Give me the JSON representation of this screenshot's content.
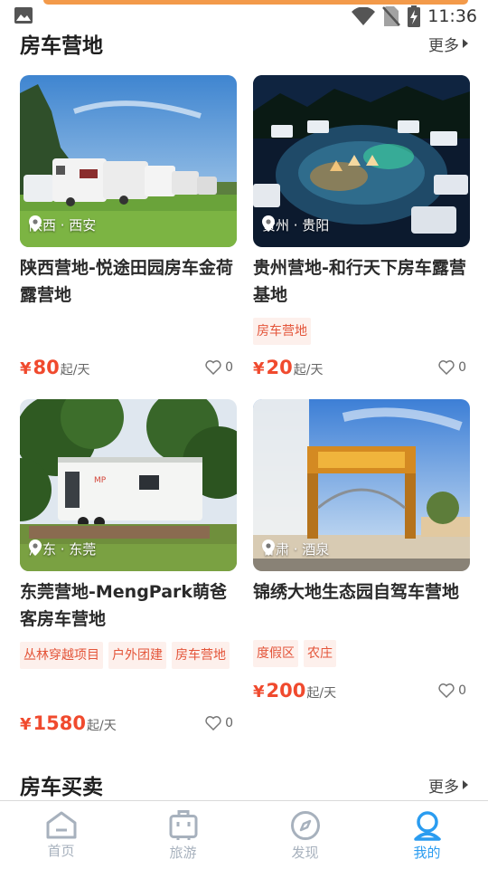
{
  "status_bar": {
    "time": "11:36"
  },
  "colors": {
    "accent": "#2a9cf0",
    "price": "#f04a2e",
    "tag_bg": "#fdf0ec",
    "tag_text": "#e4553a"
  },
  "sections": {
    "rv_camps": {
      "title": "房车营地",
      "more": "更多"
    },
    "rv_trade": {
      "title": "房车买卖",
      "more": "更多"
    }
  },
  "cards": [
    {
      "location": "陕西 · 西安",
      "title": "陕西营地-悦途田园房车金荷露营地",
      "tags": [],
      "price_symbol": "¥",
      "price": "80",
      "price_unit": "起/天",
      "likes": "0"
    },
    {
      "location": "贵州 · 贵阳",
      "title": "贵州营地-和行天下房车露营基地",
      "tags": [
        "房车营地"
      ],
      "price_symbol": "¥",
      "price": "20",
      "price_unit": "起/天",
      "likes": "0"
    },
    {
      "location": "广东 · 东莞",
      "title": "东莞营地-MengPark萌爸客房车营地",
      "tags": [
        "丛林穿越项目",
        "户外团建",
        "房车营地"
      ],
      "price_symbol": "¥",
      "price": "1580",
      "price_unit": "起/天",
      "likes": "0"
    },
    {
      "location": "甘肃 · 酒泉",
      "title": "锦绣大地生态园自驾车营地",
      "tags": [
        "度假区",
        "农庄"
      ],
      "price_symbol": "¥",
      "price": "200",
      "price_unit": "起/天",
      "likes": "0"
    }
  ],
  "bottom_nav": [
    {
      "label": "首页",
      "icon": "home-icon",
      "active": false
    },
    {
      "label": "旅游",
      "icon": "suitcase-icon",
      "active": false
    },
    {
      "label": "发现",
      "icon": "compass-icon",
      "active": false
    },
    {
      "label": "我的",
      "icon": "profile-icon",
      "active": true
    }
  ]
}
